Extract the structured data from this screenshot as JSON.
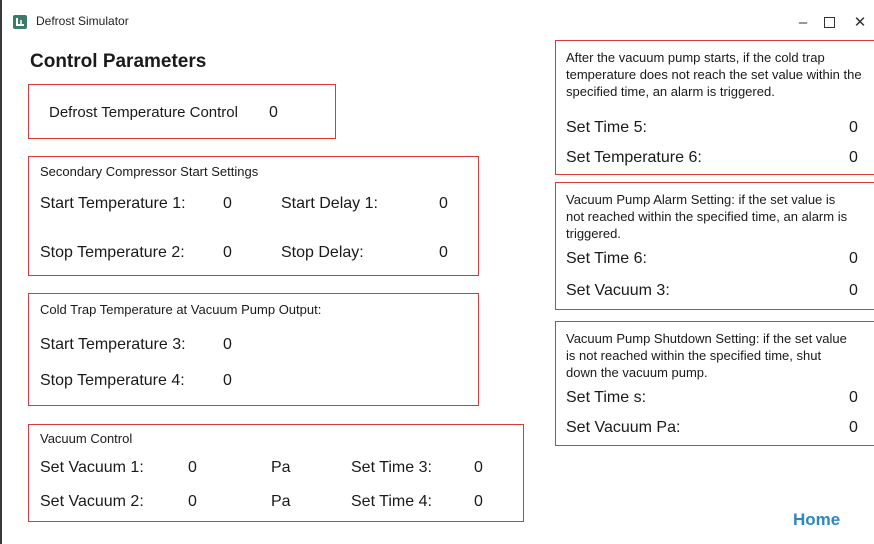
{
  "window": {
    "title": "Defrost Simulator",
    "minimize_glyph": "–",
    "close_glyph": "✕"
  },
  "heading": "Control Parameters",
  "defrost": {
    "label": "Defrost Temperature Control",
    "value": "0"
  },
  "secondary_compressor": {
    "caption": "Secondary Compressor Start Settings",
    "start_temp_label": "Start Temperature 1:",
    "start_temp_value": "0",
    "start_delay_label": "Start Delay 1:",
    "start_delay_value": "0",
    "stop_temp_label": "Stop Temperature 2:",
    "stop_temp_value": "0",
    "stop_delay_label": "Stop Delay:",
    "stop_delay_value": "0"
  },
  "cold_trap": {
    "caption": "Cold Trap Temperature at Vacuum Pump Output:",
    "start_label": "Start Temperature 3:",
    "start_value": "0",
    "stop_label": "Stop Temperature 4:",
    "stop_value": "0"
  },
  "vacuum_control": {
    "caption": "Vacuum Control",
    "vac1_label": "Set Vacuum 1:",
    "vac1_value": "0",
    "vac1_unit": "Pa",
    "time3_label": "Set Time 3:",
    "time3_value": "0",
    "vac2_label": "Set Vacuum 2:",
    "vac2_value": "0",
    "vac2_unit": "Pa",
    "time4_label": "Set Time 4:",
    "time4_value": "0"
  },
  "cold_trap_alarm": {
    "note": "After the vacuum pump starts, if the cold trap temperature does not reach the set value within the specified time, an alarm is triggered.",
    "time5_label": "Set Time 5:",
    "time5_value": "0",
    "temp6_label": "Set Temperature 6:",
    "temp6_value": "0"
  },
  "vacuum_alarm": {
    "note": "Vacuum Pump Alarm Setting: if the set value is not reached within the specified time, an alarm is triggered.",
    "time6_label": "Set Time 6:",
    "time6_value": "0",
    "vac3_label": "Set Vacuum 3:",
    "vac3_value": "0"
  },
  "vacuum_shutdown": {
    "note": "Vacuum Pump Shutdown Setting: if the set value is not reached within the specified time, shut down the vacuum pump.",
    "time_label": "Set Time s:",
    "time_value": "0",
    "vac_label": "Set Vacuum Pa:",
    "vac_value": "0"
  },
  "home_link": "Home",
  "colors": {
    "box_border": "#d9393a",
    "link": "#2d86c9"
  },
  "icons": {
    "app": "app-logo-icon",
    "minimize": "minimize-icon",
    "maximize": "maximize-icon",
    "close": "close-icon"
  }
}
